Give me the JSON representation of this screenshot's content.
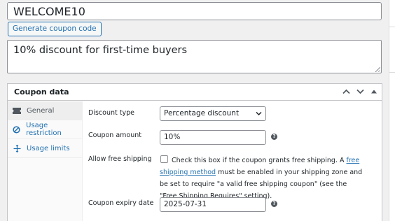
{
  "coupon": {
    "code": "WELCOME10",
    "generate_label": "Generate coupon code",
    "description": "10% discount for first-time buyers"
  },
  "panel": {
    "title": "Coupon data",
    "icons": [
      "chevron-up-icon",
      "chevron-down-icon",
      "caret-up-icon"
    ]
  },
  "tabs": [
    {
      "label": "General",
      "icon": "ticket-icon",
      "active": true
    },
    {
      "label": "Usage restriction",
      "icon": "block-icon",
      "active": false
    },
    {
      "label": "Usage limits",
      "icon": "plus-arrows-icon",
      "active": false
    }
  ],
  "fields": {
    "discount_type": {
      "label": "Discount type",
      "value": "Percentage discount"
    },
    "coupon_amount": {
      "label": "Coupon amount",
      "value": "10%"
    },
    "free_shipping": {
      "label": "Allow free shipping",
      "text_before": " Check this box if the coupon grants free shipping. A ",
      "link": "free shipping method",
      "text_after": " must be enabled in your shipping zone and be set to require \"a valid free shipping coupon\" (see the \"Free Shipping Requires\" setting).",
      "checked": false
    },
    "expiry_date": {
      "label": "Coupon expiry date",
      "value": "2025-07-31"
    }
  },
  "colors": {
    "accent": "#2271b1",
    "border": "#c3c4c7",
    "text": "#1d2327"
  }
}
